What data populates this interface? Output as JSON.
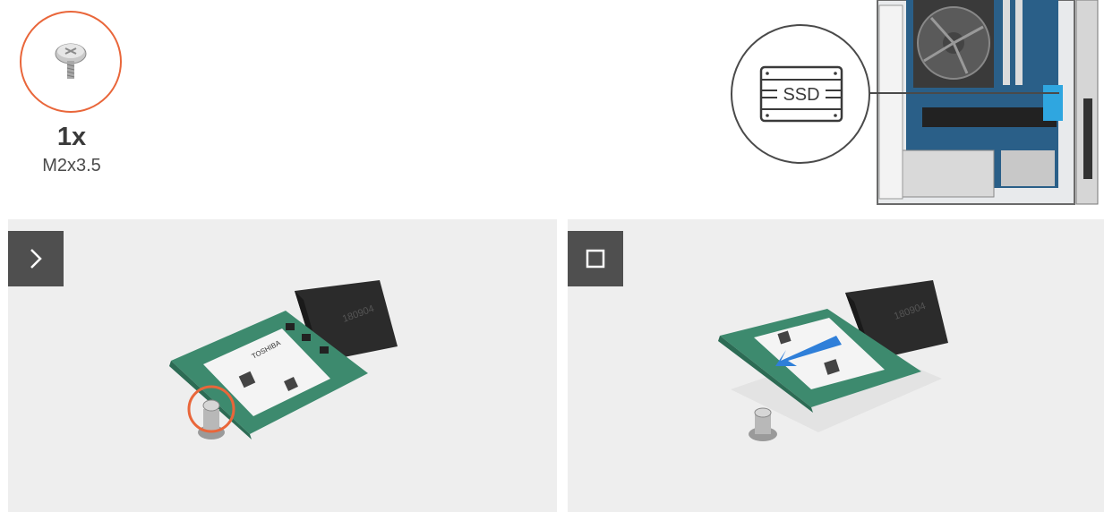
{
  "screw": {
    "quantity": "1x",
    "size": "M2x3.5"
  },
  "callout": {
    "label": "SSD"
  },
  "steps": [
    {
      "icon": "chevron-right-icon"
    },
    {
      "icon": "square-stop-icon"
    }
  ],
  "colors": {
    "accent": "#e9663a",
    "badge": "#4f4f4f",
    "panel": "#eeeeee",
    "pcb": "#3d8a6e",
    "arrow": "#2f7fd9"
  },
  "ssd_labels": {
    "brand": "TOSHIBA",
    "slot_code": "180904"
  }
}
